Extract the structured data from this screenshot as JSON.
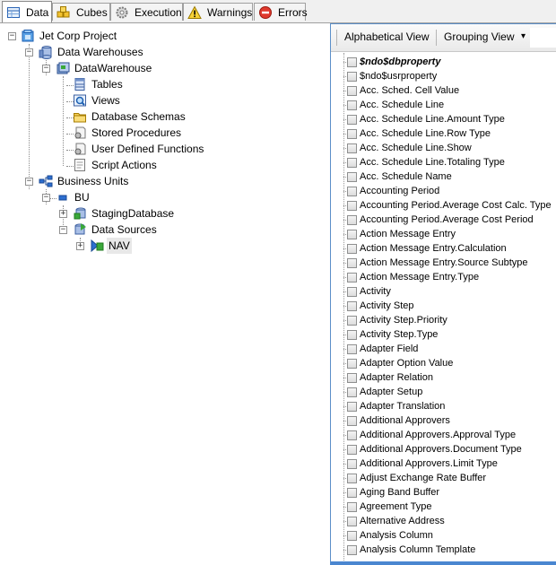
{
  "tabs": [
    {
      "label": "Data",
      "icon": "data-grid-icon"
    },
    {
      "label": "Cubes",
      "icon": "cubes-icon"
    },
    {
      "label": "Execution",
      "icon": "gear-icon"
    },
    {
      "label": "Warnings",
      "icon": "warning-icon"
    },
    {
      "label": "Errors",
      "icon": "error-icon"
    }
  ],
  "tree": {
    "root": "Jet Corp Project",
    "data_warehouses": "Data Warehouses",
    "datawarehouse": "DataWarehouse",
    "tables": "Tables",
    "views": "Views",
    "database_schemas": "Database Schemas",
    "stored_procedures": "Stored Procedures",
    "user_defined_functions": "User Defined Functions",
    "script_actions": "Script Actions",
    "business_units": "Business Units",
    "bu": "BU",
    "staging_database": "StagingDatabase",
    "data_sources": "Data Sources",
    "nav": "NAV"
  },
  "toolbar": {
    "alphabetical_view": "Alphabetical View",
    "grouping_view": "Grouping View",
    "dropdown_arrow": "▾"
  },
  "properties": [
    "$ndo$dbproperty",
    "$ndo$usrproperty",
    "Acc. Sched. Cell Value",
    "Acc. Schedule Line",
    "Acc. Schedule Line.Amount Type",
    "Acc. Schedule Line.Row Type",
    "Acc. Schedule Line.Show",
    "Acc. Schedule Line.Totaling Type",
    "Acc. Schedule Name",
    "Accounting Period",
    "Accounting Period.Average Cost Calc. Type",
    "Accounting Period.Average Cost Period",
    "Action Message Entry",
    "Action Message Entry.Calculation",
    "Action Message Entry.Source Subtype",
    "Action Message Entry.Type",
    "Activity",
    "Activity Step",
    "Activity Step.Priority",
    "Activity Step.Type",
    "Adapter Field",
    "Adapter Option Value",
    "Adapter Relation",
    "Adapter Setup",
    "Adapter Translation",
    "Additional Approvers",
    "Additional Approvers.Approval Type",
    "Additional Approvers.Document Type",
    "Additional Approvers.Limit Type",
    "Adjust Exchange Rate Buffer",
    "Aging Band Buffer",
    "Agreement Type",
    "Alternative Address",
    "Analysis Column",
    "Analysis Column Template"
  ],
  "colors": {
    "accent_blue": "#4a86d0",
    "tab_bg": "#f0f0f0"
  }
}
